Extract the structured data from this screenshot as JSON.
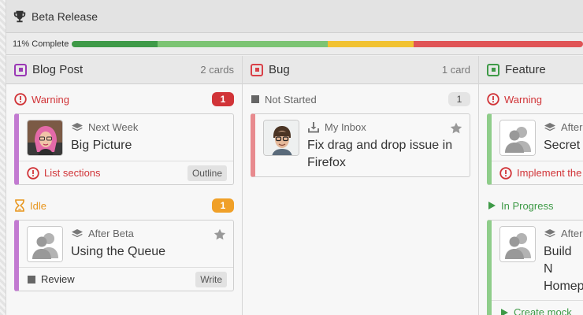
{
  "window": {
    "title": "Beta Release"
  },
  "progress": {
    "label": "11% Complete",
    "percent": 11,
    "segments": [
      {
        "color": "#3f9a48",
        "fraction": 0.168
      },
      {
        "color": "#7cc473",
        "fraction": 0.332
      },
      {
        "color": "#f1c232",
        "fraction": 0.168
      },
      {
        "color": "#e05456",
        "fraction": 0.332
      }
    ]
  },
  "colors": {
    "blog": "#9a38b5",
    "bug": "#d94047",
    "feature": "#3e9a47",
    "warning": "#d13438",
    "idle": "#e8951c",
    "in_progress": "#3e9a47",
    "not_started": "#666666"
  },
  "columns": [
    {
      "title": "Blog Post",
      "count": "2 cards",
      "groups": [
        {
          "label": "Warning",
          "badge": "1",
          "cards": [
            {
              "meta": "Next Week",
              "title": "Big Picture",
              "footer": "List sections",
              "tag": "Outline"
            }
          ]
        },
        {
          "label": "Idle",
          "badge": "1",
          "cards": [
            {
              "meta": "After Beta",
              "title": "Using the Queue",
              "footer": "Review",
              "tag": "Write"
            }
          ]
        }
      ]
    },
    {
      "title": "Bug",
      "count": "1 card",
      "groups": [
        {
          "label": "Not Started",
          "badge": "1",
          "cards": [
            {
              "meta": "My Inbox",
              "title": "Fix drag and drop issue in Firefox"
            }
          ]
        }
      ]
    },
    {
      "title": "Feature",
      "count": "",
      "groups": [
        {
          "label": "Warning",
          "cards": [
            {
              "meta": "After Beta",
              "title": "Secret",
              "footer": "Implement the"
            }
          ]
        },
        {
          "label": "In Progress",
          "cards": [
            {
              "meta": "After",
              "title": "Build N Homep",
              "footer": "Create mock"
            }
          ]
        }
      ]
    }
  ]
}
